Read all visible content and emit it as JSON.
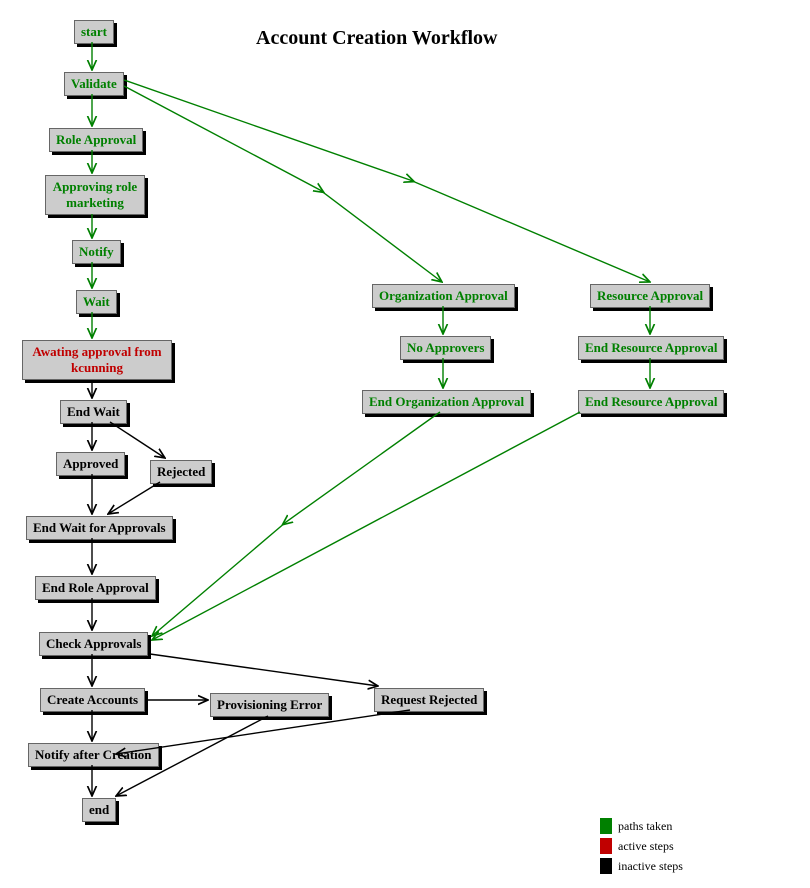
{
  "title": "Account Creation Workflow",
  "nodes": {
    "start": "start",
    "validate": "Validate",
    "role_approval": "Role Approval",
    "approving_role": "Approving role marketing",
    "notify": "Notify",
    "wait": "Wait",
    "awaiting": "Awating approval from kcunning",
    "end_wait": "End Wait",
    "approved": "Approved",
    "rejected": "Rejected",
    "end_wait_approvals": "End Wait for Approvals",
    "end_role_approval": "End Role Approval",
    "check_approvals": "Check Approvals",
    "create_accounts": "Create Accounts",
    "provisioning_error": "Provisioning Error",
    "request_rejected": "Request Rejected",
    "notify_after": "Notify after Creation",
    "end": "end",
    "org_approval": "Organization Approval",
    "no_approvers": "No Approvers",
    "end_org_approval": "End Organization Approval",
    "resource_approval": "Resource Approval",
    "end_resource_approval1": "End Resource Approval",
    "end_resource_approval2": "End Resource Approval"
  },
  "legend": {
    "paths_taken": "paths taken",
    "active_steps": "active steps",
    "inactive_steps": "inactive steps"
  }
}
